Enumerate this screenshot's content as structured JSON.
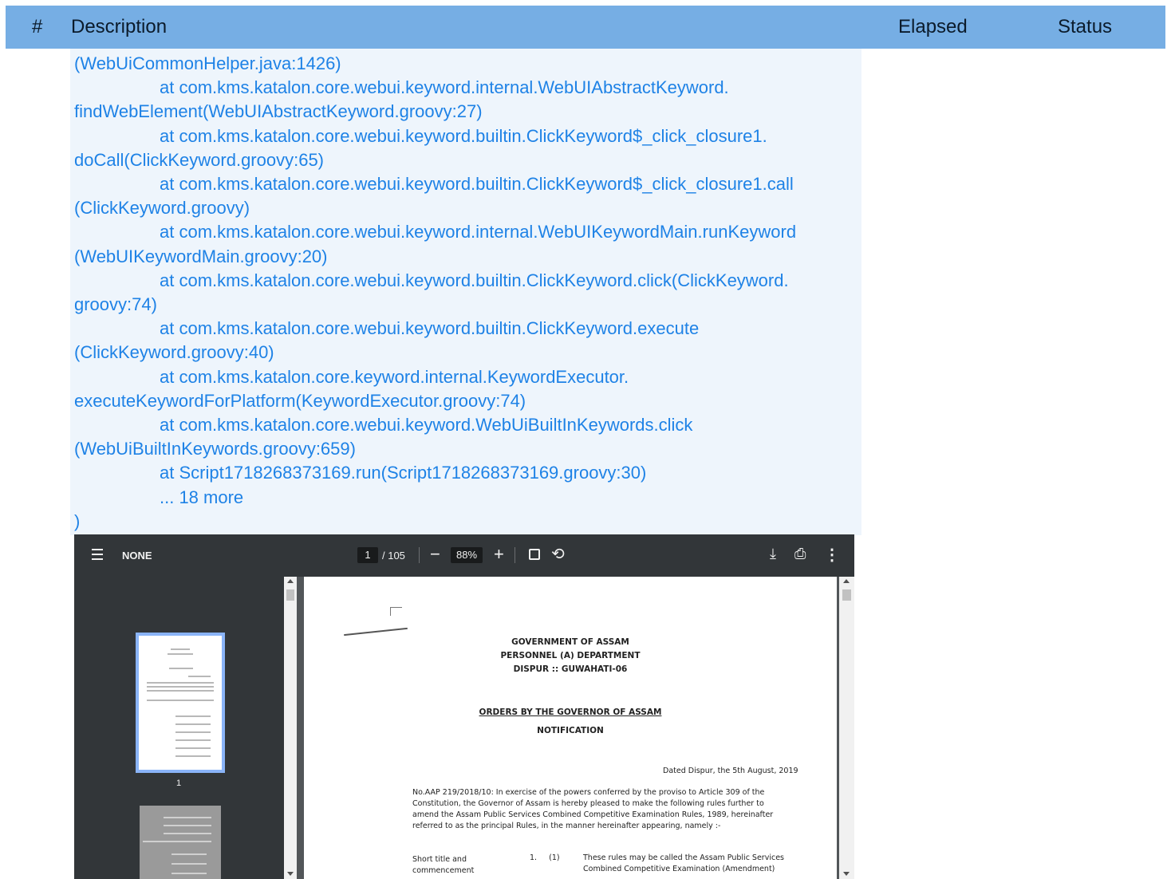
{
  "header": {
    "num_label": "#",
    "description_label": "Description",
    "elapsed_label": "Elapsed",
    "status_label": "Status"
  },
  "log_lines": [
    "(WebUiCommonHelper.java:1426)",
    "at com.kms.katalon.core.webui.keyword.internal.WebUIAbstractKeyword.",
    "findWebElement(WebUIAbstractKeyword.groovy:27)",
    "at com.kms.katalon.core.webui.keyword.builtin.ClickKeyword$_click_closure1.",
    "doCall(ClickKeyword.groovy:65)",
    "at com.kms.katalon.core.webui.keyword.builtin.ClickKeyword$_click_closure1.call",
    "(ClickKeyword.groovy)",
    "at com.kms.katalon.core.webui.keyword.internal.WebUIKeywordMain.runKeyword",
    "(WebUIKeywordMain.groovy:20)",
    "at com.kms.katalon.core.webui.keyword.builtin.ClickKeyword.click(ClickKeyword.",
    "groovy:74)",
    "at com.kms.katalon.core.webui.keyword.builtin.ClickKeyword.execute",
    "(ClickKeyword.groovy:40)",
    "at com.kms.katalon.core.keyword.internal.KeywordExecutor.",
    "executeKeywordForPlatform(KeywordExecutor.groovy:74)",
    "at com.kms.katalon.core.webui.keyword.WebUiBuiltInKeywords.click",
    "(WebUiBuiltInKeywords.groovy:659)",
    "at Script1718268373169.run(Script1718268373169.groovy:30)",
    "... 18 more",
    ")"
  ],
  "viewer": {
    "title": "NONE",
    "page_current": "1",
    "page_total": "/ 105",
    "zoom_minus": "−",
    "zoom": "88%",
    "zoom_plus": "+",
    "thumb_label": "1",
    "icons": {
      "menu": "menu-icon",
      "fit": "fit-page-icon",
      "rotate": "rotate-icon",
      "download": "download-icon",
      "print": "print-icon",
      "more": "more-icon"
    }
  },
  "document": {
    "heading1": "GOVERNMENT OF ASSAM",
    "heading2": "PERSONNEL (A) DEPARTMENT",
    "heading3": "DISPUR :: GUWAHATI-06",
    "orders": "ORDERS BY THE GOVERNOR OF ASSAM",
    "notification": "NOTIFICATION",
    "dated": "Dated Dispur, the 5th August, 2019",
    "para1": "No.AAP 219/2018/10:  In exercise of the powers conferred by the proviso to Article 309 of the",
    "para2": "Constitution, the Governor of Assam is hereby pleased to make the following rules further to",
    "para3": "amend the Assam Public Services Combined Competitive Examination Rules, 1989, hereinafter",
    "para4": "referred to as the principal Rules, in the manner hereinafter appearing, namely :-",
    "short_title1": "Short title and",
    "short_title2": "commencement",
    "clause_num": "1.     (1)",
    "clause1": "These rules may be called the Assam Public Services",
    "clause2": "Combined Competitive Examination (Amendment)"
  }
}
